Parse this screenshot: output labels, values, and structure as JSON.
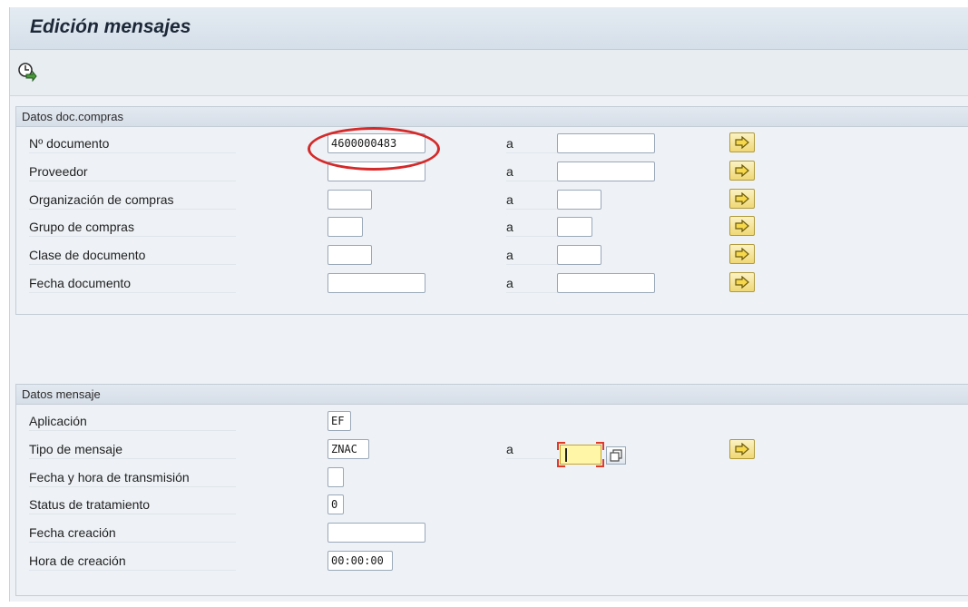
{
  "title": "Edición mensajes",
  "toolbar": {
    "execute_icon": "execute-clock-icon"
  },
  "group_docs": {
    "header": "Datos doc.compras",
    "to_label": "a",
    "rows": [
      {
        "label": "Nº documento",
        "from_value": "4600000483",
        "to_value": ""
      },
      {
        "label": "Proveedor",
        "from_value": "",
        "to_value": ""
      },
      {
        "label": "Organización de compras",
        "from_value": "",
        "to_value": ""
      },
      {
        "label": "Grupo de compras",
        "from_value": "",
        "to_value": ""
      },
      {
        "label": "Clase de documento",
        "from_value": "",
        "to_value": ""
      },
      {
        "label": "Fecha documento",
        "from_value": "",
        "to_value": ""
      }
    ]
  },
  "group_msg": {
    "header": "Datos mensaje",
    "to_label": "a",
    "rows": [
      {
        "label": "Aplicación",
        "value": "EF"
      },
      {
        "label": "Tipo de mensaje",
        "value": "ZNAC",
        "to_value": ""
      },
      {
        "label": "Fecha y hora de transmisión",
        "value": ""
      },
      {
        "label": "Status de tratamiento",
        "value": "0"
      },
      {
        "label": "Fecha creación",
        "value": ""
      },
      {
        "label": "Hora de creación",
        "value": "00:00:00"
      }
    ]
  },
  "colors": {
    "highlight": "#d42a2a",
    "multiple_selection": "#f0d875",
    "active_field": "#fff6a8"
  }
}
